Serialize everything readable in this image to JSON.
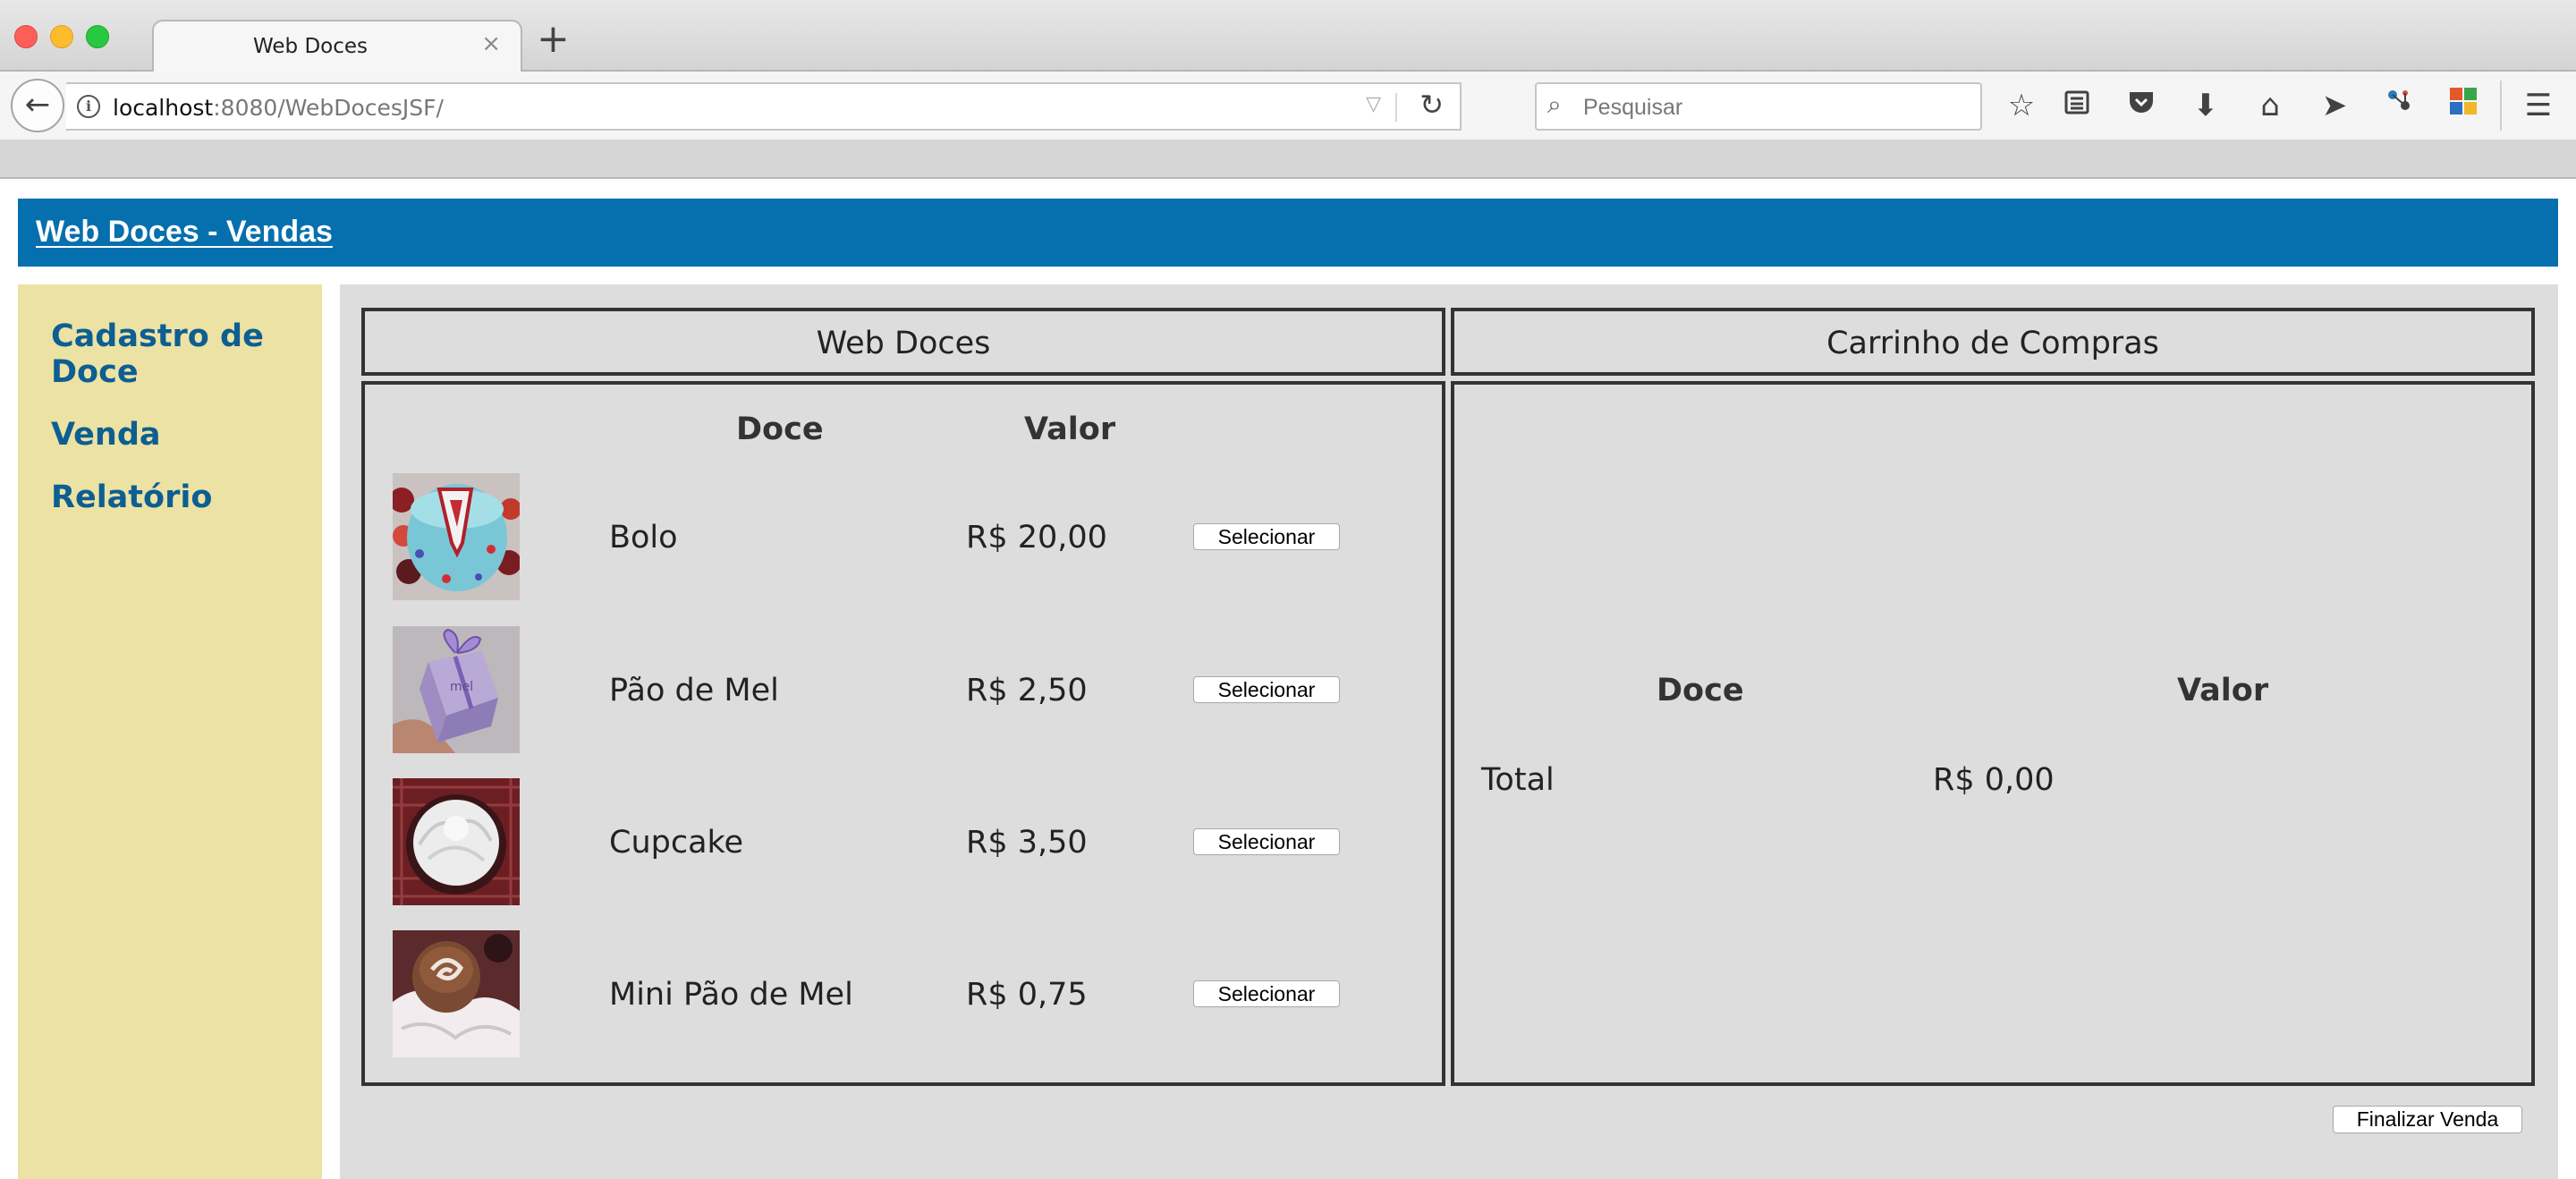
{
  "browser": {
    "tab_title": "Web Doces",
    "tab_close": "×",
    "new_tab": "+",
    "url_host": "localhost",
    "url_rest": ":8080/WebDocesJSF/",
    "search_placeholder": "Pesquisar"
  },
  "header": {
    "title": "Web Doces - Vendas"
  },
  "sidebar": {
    "items": [
      {
        "label": "Cadastro de Doce"
      },
      {
        "label": "Venda"
      },
      {
        "label": "Relatório"
      }
    ]
  },
  "products_panel": {
    "title": "Web Doces",
    "col_doce": "Doce",
    "col_valor": "Valor",
    "select_label": "Selecionar",
    "rows": [
      {
        "name": "Bolo",
        "price": "R$ 20,00",
        "image": "cake"
      },
      {
        "name": "Pão de Mel",
        "price": "R$ 2,50",
        "image": "gift-box"
      },
      {
        "name": "Cupcake",
        "price": "R$ 3,50",
        "image": "cupcake"
      },
      {
        "name": "Mini Pão de Mel",
        "price": "R$ 0,75",
        "image": "chocolate-bonbon"
      }
    ]
  },
  "cart_panel": {
    "title": "Carrinho de Compras",
    "col_doce": "Doce",
    "col_valor": "Valor",
    "total_label": "Total",
    "total_value": "R$ 0,00"
  },
  "footer": {
    "finalize_label": "Finalizar Venda"
  },
  "colors": {
    "header_bg": "#0570ad",
    "sidebar_bg": "#ece2a4",
    "link_color": "#0d5e92",
    "content_bg": "#dddddd"
  }
}
